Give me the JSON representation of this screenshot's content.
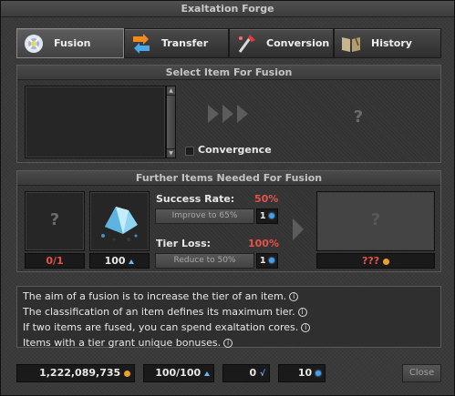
{
  "window": {
    "title": "Exaltation Forge"
  },
  "tabs": [
    {
      "label": "Fusion",
      "active": true,
      "icon": "fusion-orb-icon"
    },
    {
      "label": "Transfer",
      "active": false,
      "icon": "transfer-arrows-icon"
    },
    {
      "label": "Conversion",
      "active": false,
      "icon": "conversion-wand-icon"
    },
    {
      "label": "History",
      "active": false,
      "icon": "history-book-icon"
    }
  ],
  "select_panel": {
    "heading": "Select Item For Fusion",
    "result_placeholder": "?",
    "convergence_label": "Convergence",
    "convergence_checked": false
  },
  "further_panel": {
    "heading": "Further Items Needed For Fusion",
    "item_slot_placeholder": "?",
    "item_count": "0/1",
    "core_count": "100",
    "success_rate_label": "Success Rate:",
    "success_rate_value": "50%",
    "improve_button": "Improve to 65%",
    "improve_cost": "1",
    "tier_loss_label": "Tier Loss:",
    "tier_loss_value": "100%",
    "reduce_button": "Reduce to 50%",
    "reduce_cost": "1",
    "result_price": "???"
  },
  "info_lines": [
    "The aim of a fusion is to increase the tier of an item.",
    "The classification of an item defines its maximum tier.",
    "If two items are fused, you can spend exaltation cores.",
    "Items with a tier grant unique bonuses."
  ],
  "footer": {
    "gold": "1,222,089,735",
    "cores": "100/100",
    "dust": "0",
    "gems": "10",
    "close_label": "Close"
  },
  "colors": {
    "accent_red": "#e4534a",
    "gem_blue": "#3da0f0",
    "gold": "#e8a22c"
  }
}
